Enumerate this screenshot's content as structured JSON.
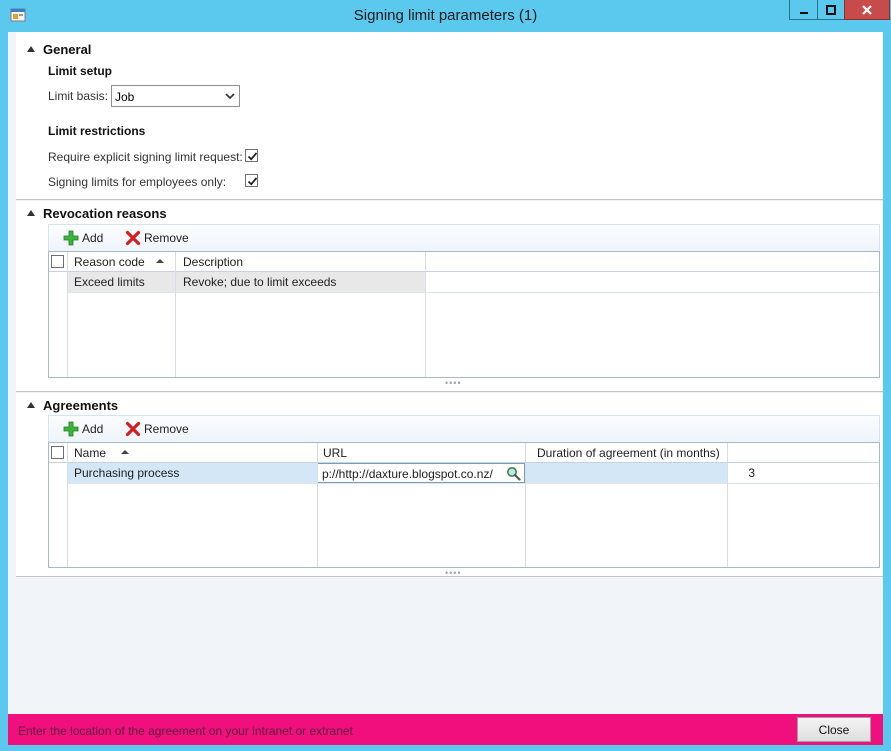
{
  "window": {
    "title": "Signing limit parameters (1)",
    "app_icon": "ax-app-icon",
    "controls": [
      "minimize-icon",
      "maximize-icon",
      "close-icon"
    ]
  },
  "general": {
    "title": "General",
    "limit_setup": {
      "title": "Limit setup",
      "limit_basis_label": "Limit basis:",
      "limit_basis_value": "Job"
    },
    "limit_restrictions": {
      "title": "Limit restrictions",
      "require_explicit_label": "Require explicit signing limit request:",
      "require_explicit_checked": true,
      "employees_only_label": "Signing limits for employees only:",
      "employees_only_checked": true
    }
  },
  "revocation": {
    "title": "Revocation reasons",
    "add_label": "Add",
    "remove_label": "Remove",
    "columns": [
      "Reason code",
      "Description"
    ],
    "rows": [
      {
        "reason_code": "Exceed limits",
        "description": "Revoke; due to limit exceeds"
      }
    ]
  },
  "agreements": {
    "title": "Agreements",
    "add_label": "Add",
    "remove_label": "Remove",
    "columns": [
      "Name",
      "URL",
      "Duration of agreement (in months)"
    ],
    "rows": [
      {
        "name": "Purchasing process",
        "url": "p://http://daxture.blogspot.co.nz/",
        "duration": "3"
      }
    ]
  },
  "status": {
    "help_text": "Enter the location of the agreement on your intranet or extranet",
    "close_label": "Close"
  },
  "colors": {
    "titlebar": "#5bc8ee",
    "statusbar": "#f00f7d",
    "selected_row": "#d3e7f7"
  }
}
